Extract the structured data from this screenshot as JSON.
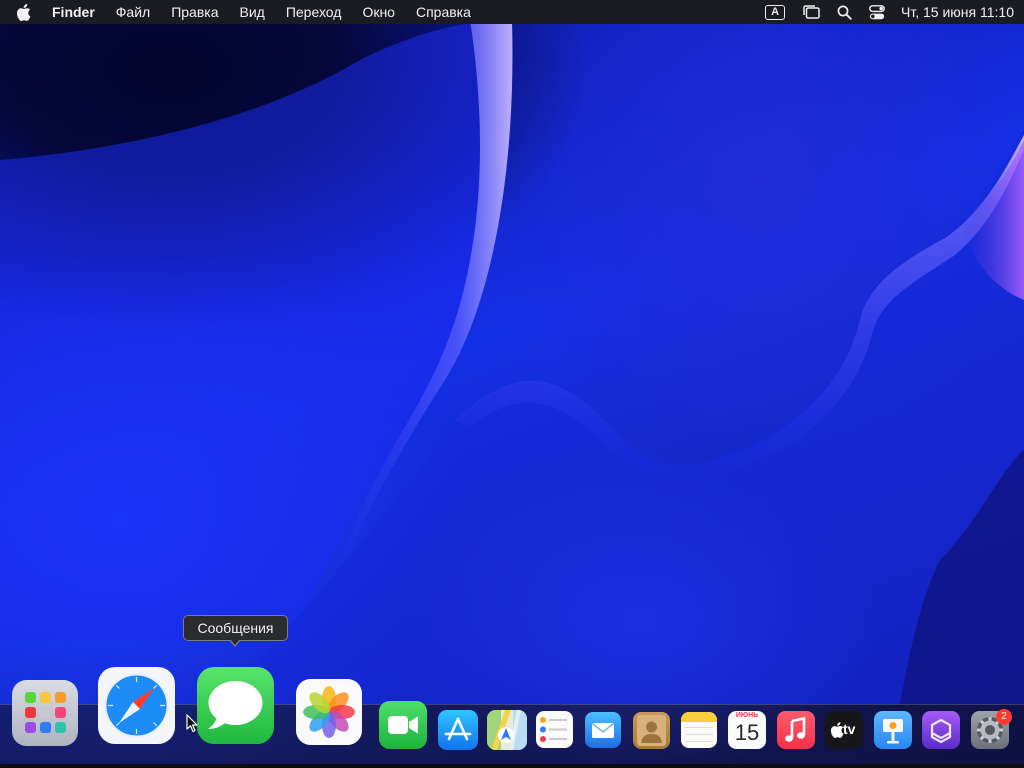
{
  "menubar": {
    "app_name": "Finder",
    "items": [
      "Файл",
      "Правка",
      "Вид",
      "Переход",
      "Окно",
      "Справка"
    ],
    "input_source": "A",
    "clock": "Чт, 15 июня  11:10"
  },
  "tooltip": {
    "text": "Сообщения"
  },
  "dock": {
    "calendar_month": "ИЮНЬ",
    "calendar_day": "15",
    "tv_label": "tv",
    "settings_badge": "2"
  },
  "colors": {
    "menubar_bg": "#1b1c22",
    "facetime_green": "#2fc14a",
    "messages_green": "#34d058",
    "appstore_blue": "#1a8cf6",
    "mail_blue": "#2f8ff5",
    "music_red": "#fb3b57",
    "badge_red": "#ff3b30"
  }
}
